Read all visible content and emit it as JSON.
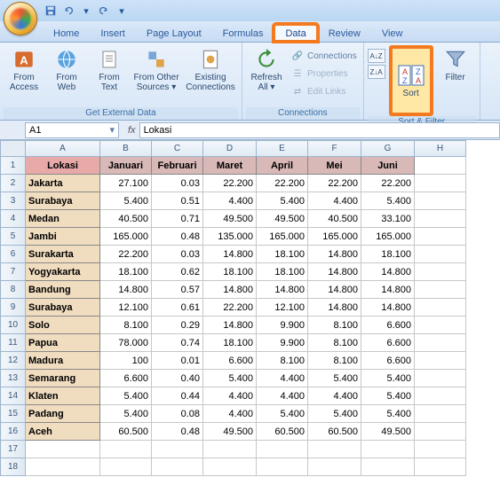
{
  "qat": {
    "save": "save-icon",
    "undo": "undo-icon",
    "redo": "redo-icon"
  },
  "tabs": {
    "home": "Home",
    "insert": "Insert",
    "pagelayout": "Page Layout",
    "formulas": "Formulas",
    "data": "Data",
    "review": "Review",
    "view": "View"
  },
  "ribbon": {
    "getdata": {
      "label": "Get External Data",
      "access": "From\nAccess",
      "web": "From\nWeb",
      "text": "From\nText",
      "other": "From Other\nSources ▾",
      "existing": "Existing\nConnections"
    },
    "connections": {
      "label": "Connections",
      "refresh": "Refresh\nAll ▾",
      "conn": "Connections",
      "props": "Properties",
      "links": "Edit Links"
    },
    "sortfilter": {
      "label": "Sort & Filter",
      "sort": "Sort",
      "filter": "Filter"
    }
  },
  "namebox": "A1",
  "fx_label": "fx",
  "formula": "Lokasi",
  "columns": [
    "A",
    "B",
    "C",
    "D",
    "E",
    "F",
    "G",
    "H"
  ],
  "header_row": [
    "Lokasi",
    "Januari",
    "Februari",
    "Maret",
    "April",
    "Mei",
    "Juni"
  ],
  "rows": [
    {
      "n": 1
    },
    {
      "n": 2,
      "lok": "Jakarta",
      "v": [
        "27.100",
        "0.03",
        "22.200",
        "22.200",
        "22.200",
        "22.200"
      ]
    },
    {
      "n": 3,
      "lok": "Surabaya",
      "v": [
        "5.400",
        "0.51",
        "4.400",
        "5.400",
        "4.400",
        "5.400"
      ]
    },
    {
      "n": 4,
      "lok": "Medan",
      "v": [
        "40.500",
        "0.71",
        "49.500",
        "49.500",
        "40.500",
        "33.100"
      ]
    },
    {
      "n": 5,
      "lok": "Jambi",
      "v": [
        "165.000",
        "0.48",
        "135.000",
        "165.000",
        "165.000",
        "165.000"
      ]
    },
    {
      "n": 6,
      "lok": "Surakarta",
      "v": [
        "22.200",
        "0.03",
        "14.800",
        "18.100",
        "14.800",
        "18.100"
      ]
    },
    {
      "n": 7,
      "lok": "Yogyakarta",
      "v": [
        "18.100",
        "0.62",
        "18.100",
        "18.100",
        "14.800",
        "14.800"
      ]
    },
    {
      "n": 8,
      "lok": "Bandung",
      "v": [
        "14.800",
        "0.57",
        "14.800",
        "14.800",
        "14.800",
        "14.800"
      ]
    },
    {
      "n": 9,
      "lok": "Surabaya",
      "v": [
        "12.100",
        "0.61",
        "22.200",
        "12.100",
        "14.800",
        "14.800"
      ]
    },
    {
      "n": 10,
      "lok": "Solo",
      "v": [
        "8.100",
        "0.29",
        "14.800",
        "9.900",
        "8.100",
        "6.600"
      ]
    },
    {
      "n": 11,
      "lok": "Papua",
      "v": [
        "78.000",
        "0.74",
        "18.100",
        "9.900",
        "8.100",
        "6.600"
      ]
    },
    {
      "n": 12,
      "lok": "Madura",
      "v": [
        "100",
        "0.01",
        "6.600",
        "8.100",
        "8.100",
        "6.600"
      ]
    },
    {
      "n": 13,
      "lok": "Semarang",
      "v": [
        "6.600",
        "0.40",
        "5.400",
        "4.400",
        "5.400",
        "5.400"
      ]
    },
    {
      "n": 14,
      "lok": "Klaten",
      "v": [
        "5.400",
        "0.44",
        "4.400",
        "4.400",
        "4.400",
        "5.400"
      ]
    },
    {
      "n": 15,
      "lok": "Padang",
      "v": [
        "5.400",
        "0.08",
        "4.400",
        "5.400",
        "5.400",
        "5.400"
      ]
    },
    {
      "n": 16,
      "lok": "Aceh",
      "v": [
        "60.500",
        "0.48",
        "49.500",
        "60.500",
        "60.500",
        "49.500"
      ]
    },
    {
      "n": 17
    },
    {
      "n": 18
    }
  ]
}
